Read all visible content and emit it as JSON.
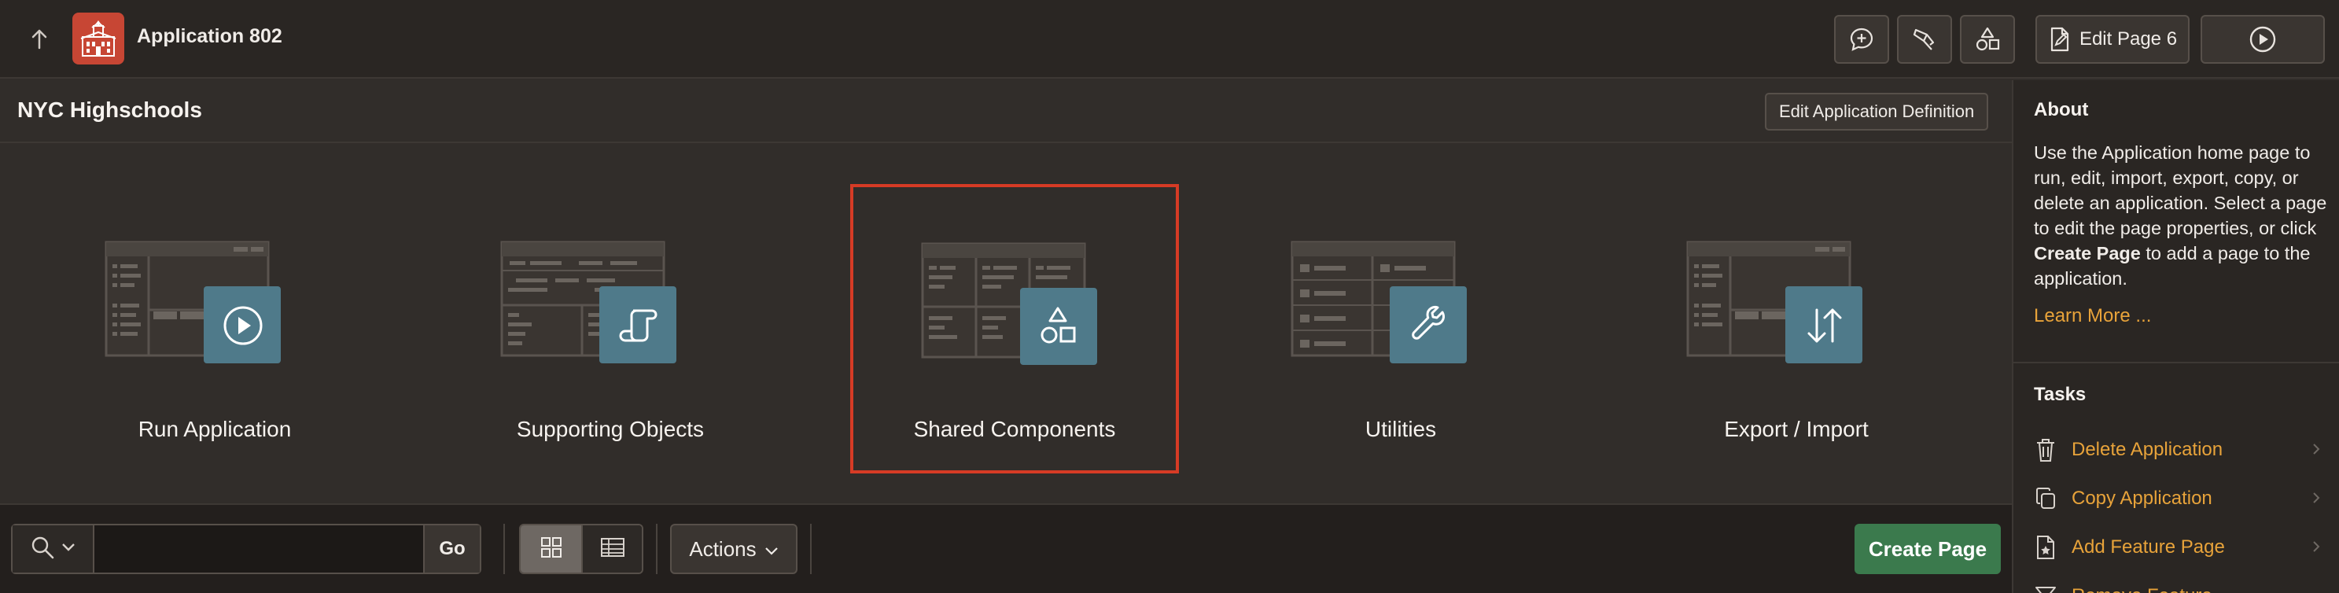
{
  "topbar": {
    "app_title": "Application 802",
    "edit_page_label": "Edit Page 6"
  },
  "main": {
    "heading": "NYC Highschools",
    "edit_definition_label": "Edit Application Definition",
    "tiles": [
      {
        "label": "Run Application",
        "icon": "play-icon"
      },
      {
        "label": "Supporting Objects",
        "icon": "scroll-icon"
      },
      {
        "label": "Shared Components",
        "icon": "shapes-icon",
        "selected": true
      },
      {
        "label": "Utilities",
        "icon": "wrench-icon"
      },
      {
        "label": "Export / Import",
        "icon": "arrows-up-down-icon"
      }
    ]
  },
  "toolbar": {
    "search_value": "",
    "go_label": "Go",
    "actions_label": "Actions",
    "create_page_label": "Create Page"
  },
  "sidebar": {
    "about_heading": "About",
    "about_text_1": "Use the Application home page to run, edit, import, export, copy, or delete an application. Select a page to edit the page properties, or click ",
    "about_bold": "Create Page",
    "about_text_2": " to add a page to the application.",
    "learn_more": "Learn More ...",
    "tasks_heading": "Tasks",
    "tasks": [
      {
        "label": "Delete Application",
        "icon": "trash-icon"
      },
      {
        "label": "Copy Application",
        "icon": "copy-icon"
      },
      {
        "label": "Add Feature Page",
        "icon": "feature-page-icon"
      },
      {
        "label": "Remove Feature",
        "icon": "funnel-icon"
      }
    ]
  },
  "colors": {
    "accent_orange": "#e8a33a",
    "selection_border": "#d63b25",
    "tile_badge": "#4f7a8a",
    "create_button": "#3b7a4d",
    "app_logo": "#c74634"
  }
}
